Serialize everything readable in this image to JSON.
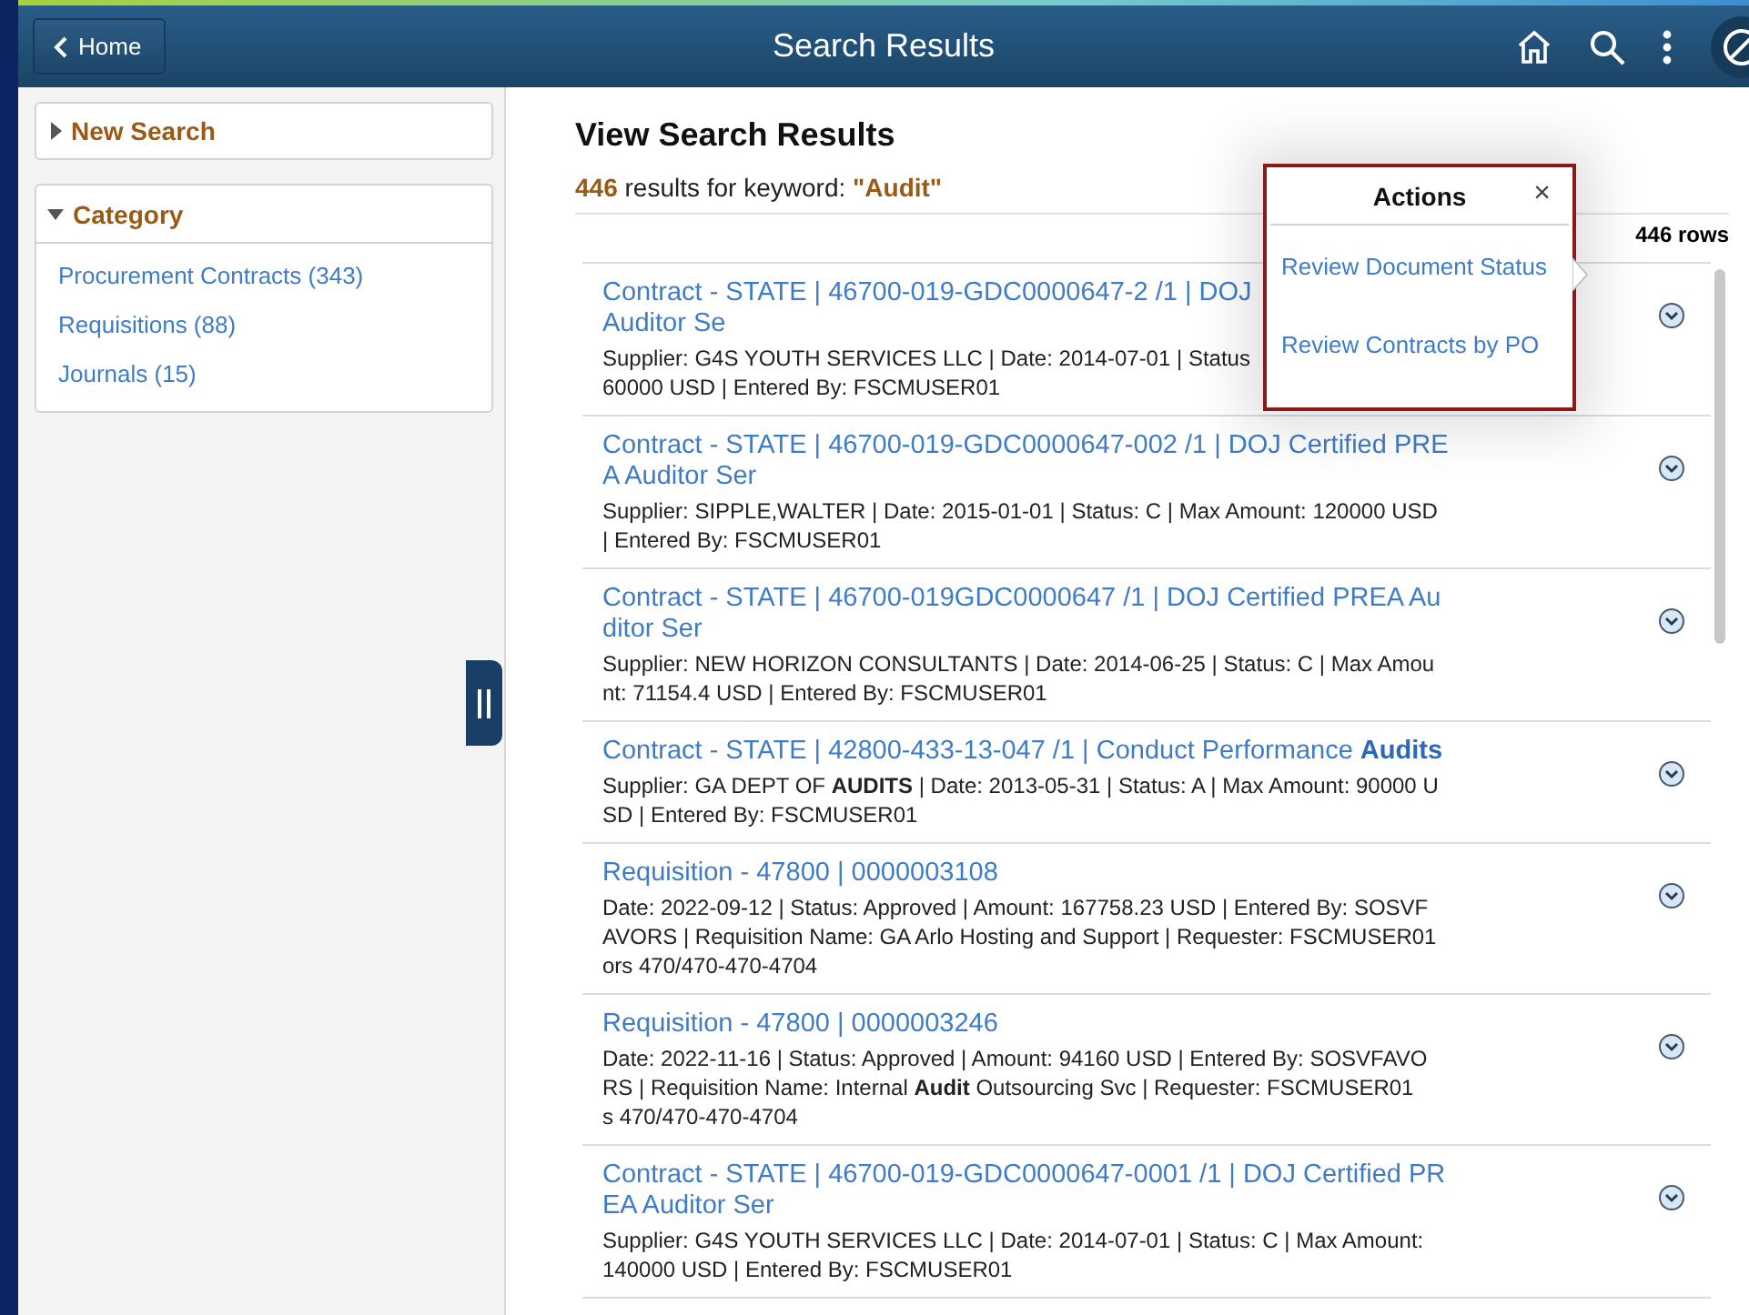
{
  "header": {
    "back_label": "Home",
    "title": "Search Results"
  },
  "sidebar": {
    "panels": [
      {
        "label": "New Search",
        "expanded": false
      },
      {
        "label": "Category",
        "expanded": true,
        "items": [
          "Procurement Contracts (343)",
          "Requisitions (88)",
          "Journals (15)"
        ]
      }
    ]
  },
  "results": {
    "heading": "View Search Results",
    "summary": "**446** results for keyword: **\"Audit\"**",
    "row_count": "446 rows",
    "items": [
      {
        "title_lines": [
          "Contract - STATE | 46700-019-GDC0000647-2 /1 | DOJ",
          "Auditor Se"
        ],
        "detail_lines": [
          "Supplier: G4S YOUTH SERVICES LLC | Date: 2014-07-01 | Status",
          "60000 USD | Entered By: FSCMUSER01"
        ]
      },
      {
        "title_lines": [
          "Contract - STATE | 46700-019-GDC0000647-002 /1 | DOJ Certified PRE",
          "A Auditor Ser"
        ],
        "detail_lines": [
          "Supplier: SIPPLE,WALTER | Date: 2015-01-01 | Status: C | Max Amount: 120000 USD",
          "| Entered By: FSCMUSER01"
        ]
      },
      {
        "title_lines": [
          "Contract - STATE | 46700-019GDC0000647 /1 | DOJ Certified PREA Au",
          "ditor Ser"
        ],
        "detail_lines": [
          "Supplier: NEW HORIZON CONSULTANTS | Date: 2014-06-25 | Status: C | Max Amou",
          "nt: 71154.4 USD | Entered By: FSCMUSER01"
        ]
      },
      {
        "title_lines": [
          "Contract - STATE | 42800-433-13-047 /1 | Conduct Performance **Audits**"
        ],
        "detail_lines": [
          "Supplier: GA DEPT OF **AUDITS** | Date: 2013-05-31 | Status: A | Max Amount: 90000 U",
          "SD | Entered By: FSCMUSER01"
        ]
      },
      {
        "title_lines": [
          "Requisition - 47800 | 0000003108"
        ],
        "detail_lines": [
          "Date: 2022-09-12 | Status: Approved | Amount: 167758.23 USD | Entered By: SOSVF",
          "AVORS | Requisition Name: GA Arlo Hosting and Support | Requester: FSCMUSER01",
          "ors 470/470-470-4704"
        ]
      },
      {
        "title_lines": [
          "Requisition - 47800 | 0000003246"
        ],
        "detail_lines": [
          "Date: 2022-11-16 | Status: Approved | Amount: 94160 USD | Entered By: SOSVFAVO",
          "RS | Requisition Name: Internal **Audit** Outsourcing Svc | Requester: FSCMUSER01",
          "s 470/470-470-4704"
        ]
      },
      {
        "title_lines": [
          "Contract - STATE | 46700-019-GDC0000647-0001 /1 | DOJ Certified PR",
          "EA Auditor Ser"
        ],
        "detail_lines": [
          "Supplier: G4S YOUTH SERVICES LLC | Date: 2014-07-01 | Status: C | Max Amount:",
          "140000 USD | Entered By: FSCMUSER01"
        ]
      }
    ]
  },
  "actions_popup": {
    "title": "Actions",
    "close": "×",
    "items": [
      "Review Document Status",
      "Review Contracts by PO"
    ]
  }
}
